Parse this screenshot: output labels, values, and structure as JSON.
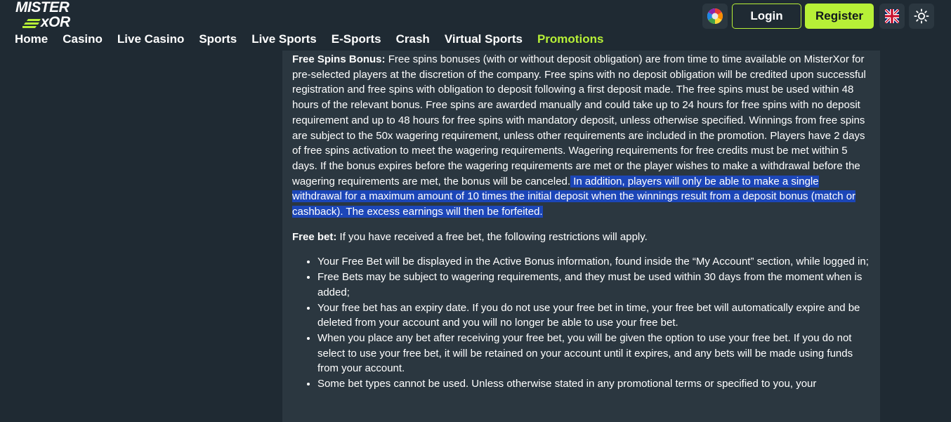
{
  "logo": {
    "line1": "MISTER",
    "line2": "xOR"
  },
  "nav": [
    {
      "label": "Home"
    },
    {
      "label": "Casino"
    },
    {
      "label": "Live Casino"
    },
    {
      "label": "Sports"
    },
    {
      "label": "Live Sports"
    },
    {
      "label": "E-Sports"
    },
    {
      "label": "Crash"
    },
    {
      "label": "Virtual Sports"
    },
    {
      "label": "Promotions"
    }
  ],
  "nav_active_index": 8,
  "header_actions": {
    "login_label": "Login",
    "register_label": "Register",
    "icons": [
      "color-wheel-icon",
      "uk-flag-icon",
      "sun-icon"
    ]
  },
  "colors": {
    "accent": "#b7f037",
    "background": "#1f2a33",
    "panel": "#2b3740",
    "selection": "#1c46b8"
  },
  "terms": {
    "free_spins_title": "Free Spins Bonus:",
    "free_spins_text": " Free spins bonuses (with or without deposit obligation) are from time to time available on MisterXor for pre-selected players at the discretion of the company. Free spins with no deposit obligation will be credited upon successful registration and free spins with obligation to deposit following a first deposit made. The free spins must be used within 48 hours of the relevant bonus. Free spins are awarded manually and could take up to 24 hours for free spins with no deposit requirement and up to 48 hours for free spins with mandatory deposit, unless otherwise specified. Winnings from free spins are subject to the 50x wagering requirement, unless other requirements are included in the promotion. Players have 2 days of free spins activation to meet the wagering requirements. Wagering requirements for free credits must be met within 5 days. If the bonus expires before the wagering requirements are met or the player wishes to make a withdrawal before the wagering requirements are met, the bonus will be canceled.",
    "free_spins_highlighted": " In addition, players will only be able to make a single withdrawal for a maximum amount of 10 times the initial deposit when the winnings result from a deposit bonus (match or cashback). The excess earnings will then be forfeited.",
    "free_bet_title": "Free bet:",
    "free_bet_intro": " If you have received a free bet, the following restrictions will apply.",
    "free_bet_rules": [
      "Your Free Bet will be displayed in the Active Bonus information, found inside the “My Account” section, while logged in;",
      "Free Bets may be subject to wagering requirements, and they must be used within 30 days from the moment when is added;",
      "Your free bet has an expiry date. If you do not use your free bet in time, your free bet will automatically expire and be deleted from your account and you will no longer be able to use your free bet.",
      "When you place any bet after receiving your free bet, you will be given the option to use your free bet. If you do not select to use your free bet, it will be retained on your account until it expires, and any bets will be made using funds from your account.",
      "Some bet types cannot be used. Unless otherwise stated in any promotional terms or specified to you, your"
    ]
  }
}
